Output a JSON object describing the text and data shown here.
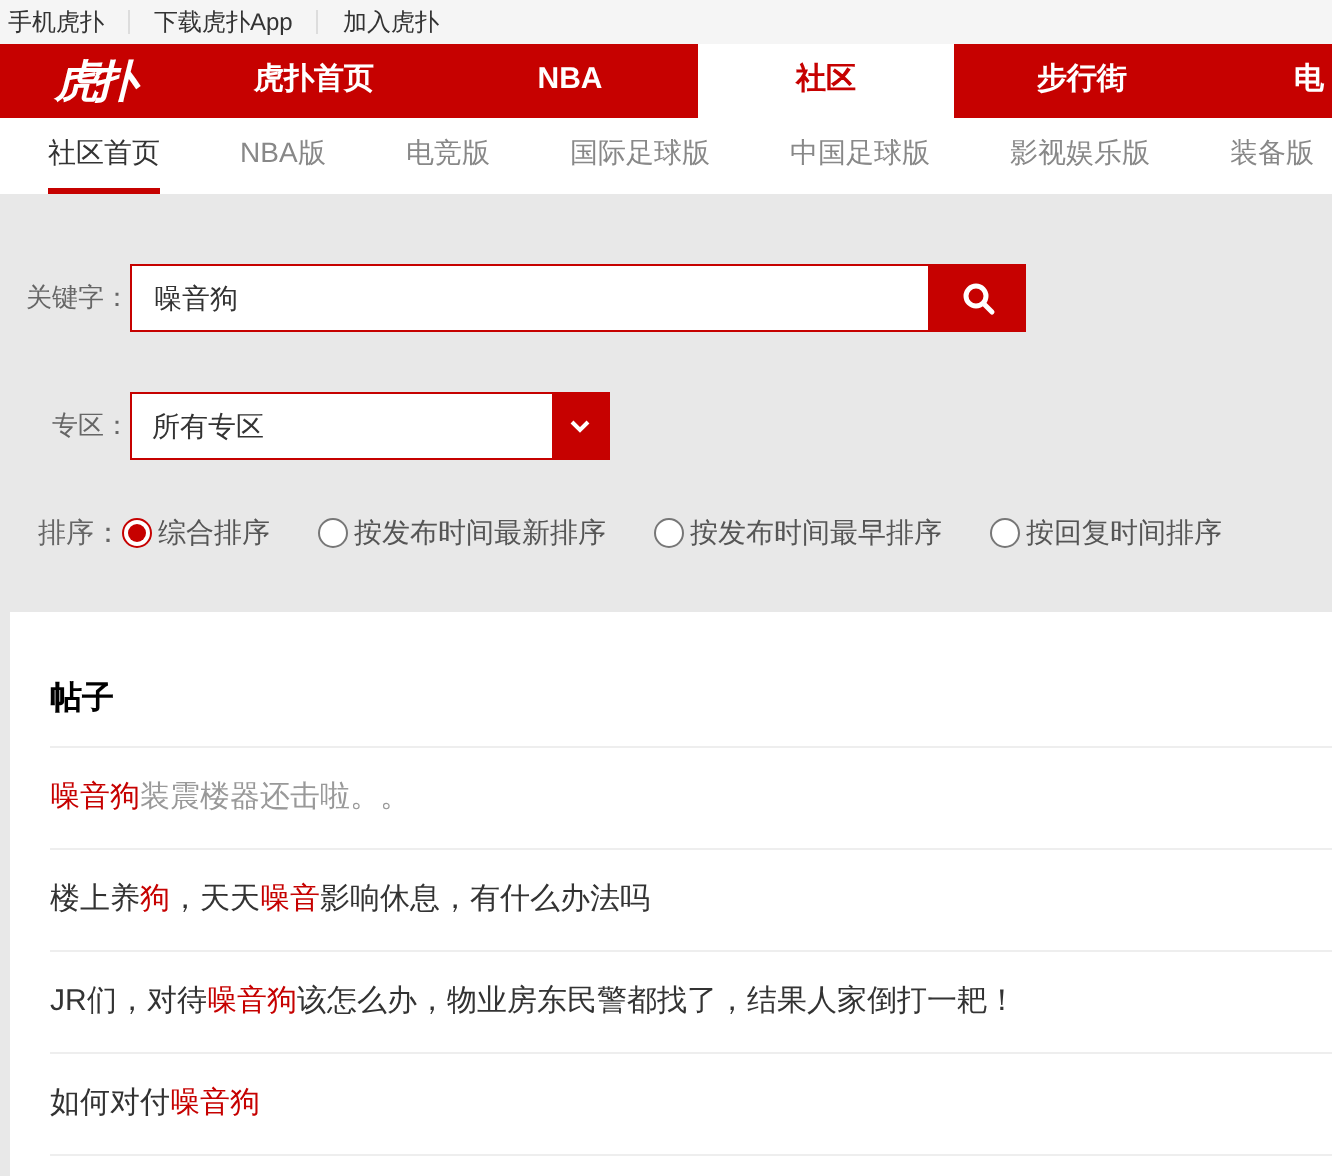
{
  "top_links": [
    "手机虎扑",
    "下载虎扑App",
    "加入虎扑"
  ],
  "logo": "虎扑",
  "main_nav": [
    {
      "label": "虎扑首页",
      "selected": false
    },
    {
      "label": "NBA",
      "selected": false
    },
    {
      "label": "社区",
      "selected": true
    },
    {
      "label": "步行街",
      "selected": false
    },
    {
      "label": "电",
      "selected": false
    }
  ],
  "sub_nav": [
    {
      "label": "社区首页",
      "selected": true
    },
    {
      "label": "NBA版",
      "selected": false
    },
    {
      "label": "电竞版",
      "selected": false
    },
    {
      "label": "国际足球版",
      "selected": false
    },
    {
      "label": "中国足球版",
      "selected": false
    },
    {
      "label": "影视娱乐版",
      "selected": false
    },
    {
      "label": "装备版",
      "selected": false
    }
  ],
  "search": {
    "label": "关键字：",
    "value": "噪音狗"
  },
  "zone": {
    "label": "专区：",
    "value": "所有专区"
  },
  "sort": {
    "label": "排序：",
    "options": [
      {
        "label": "综合排序",
        "selected": true
      },
      {
        "label": "按发布时间最新排序",
        "selected": false
      },
      {
        "label": "按发布时间最早排序",
        "selected": false
      },
      {
        "label": "按回复时间排序",
        "selected": false
      }
    ]
  },
  "posts": {
    "heading": "帖子",
    "items": [
      {
        "visited": true,
        "segments": [
          {
            "text": "噪音狗",
            "highlight": true
          },
          {
            "text": "装震楼器还击啦。。",
            "highlight": false
          }
        ]
      },
      {
        "visited": false,
        "segments": [
          {
            "text": "楼上养",
            "highlight": false
          },
          {
            "text": "狗",
            "highlight": true
          },
          {
            "text": "，天天",
            "highlight": false
          },
          {
            "text": "噪音",
            "highlight": true
          },
          {
            "text": "影响休息，有什么办法吗",
            "highlight": false
          }
        ]
      },
      {
        "visited": false,
        "segments": [
          {
            "text": "JR们，对待",
            "highlight": false
          },
          {
            "text": "噪音狗",
            "highlight": true
          },
          {
            "text": "该怎么办，物业房东民警都找了，结果人家倒打一耙！",
            "highlight": false
          }
        ]
      },
      {
        "visited": false,
        "segments": [
          {
            "text": "如何对付",
            "highlight": false
          },
          {
            "text": "噪音狗",
            "highlight": true
          }
        ]
      }
    ]
  }
}
